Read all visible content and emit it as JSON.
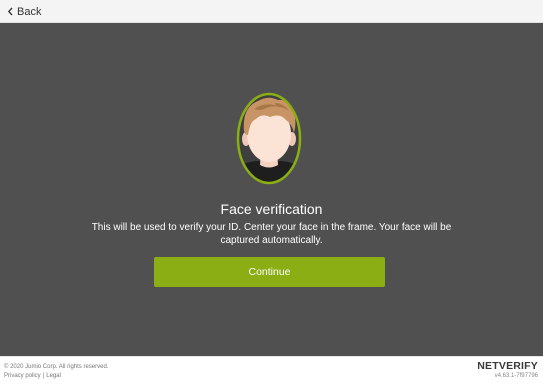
{
  "header": {
    "back_label": "Back"
  },
  "main": {
    "title": "Face verification",
    "description": "This will be used to verify your ID. Center your face in the frame. Your face will be captured automatically.",
    "continue_label": "Continue"
  },
  "footer": {
    "copyright": "© 2020 Jumio Corp. All rights reserved.",
    "privacy_label": "Privacy policy",
    "separator": "|",
    "legal_label": "Legal",
    "brand": "NETVERIFY",
    "version": "v4.63.1-7f97796"
  },
  "colors": {
    "background": "#505050",
    "accent": "#8bae14",
    "topbar": "#f4f4f4"
  },
  "icons": [
    "chevron-left-icon",
    "face-outline-icon"
  ]
}
